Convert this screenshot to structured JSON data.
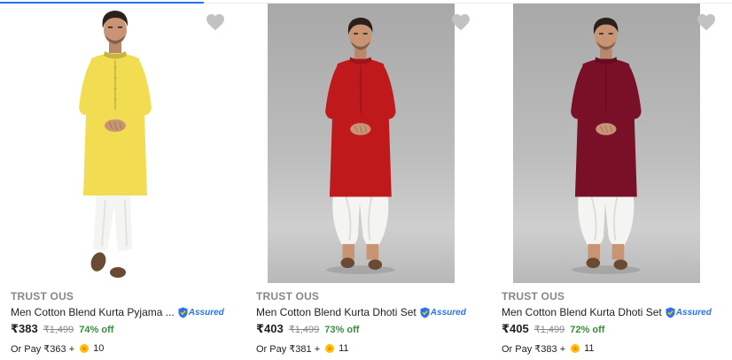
{
  "colors": {
    "accent": "#2874f0",
    "discount_green": "#388e3c",
    "muted_gray": "#878787",
    "wishlist_gray": "#c2c2c2",
    "supercoin_gold": "#ffc200"
  },
  "icons": {
    "wishlist": "heart-icon",
    "assured": "assured-shield-icon",
    "coin": "supercoin-icon"
  },
  "products": [
    {
      "brand": "TRUST OUS",
      "title": "Men Cotton Blend Kurta Pyjama ...",
      "assured_label": "Assured",
      "price": "₹383",
      "mrp": "₹1,499",
      "discount": "74% off",
      "pay_text": "Or Pay ₹363 +",
      "coins": "10",
      "kurta_color": "#f2dc52",
      "bottom_style": "pyjama"
    },
    {
      "brand": "TRUST OUS",
      "title": "Men Cotton Blend Kurta Dhoti Set",
      "assured_label": "Assured",
      "price": "₹403",
      "mrp": "₹1,499",
      "discount": "73% off",
      "pay_text": "Or Pay ₹381 +",
      "coins": "11",
      "kurta_color": "#c0191c",
      "bottom_style": "dhoti"
    },
    {
      "brand": "TRUST OUS",
      "title": "Men Cotton Blend Kurta Dhoti Set",
      "assured_label": "Assured",
      "price": "₹405",
      "mrp": "₹1,499",
      "discount": "72% off",
      "pay_text": "Or Pay ₹383 +",
      "coins": "11",
      "kurta_color": "#7a1027",
      "bottom_style": "dhoti"
    }
  ]
}
